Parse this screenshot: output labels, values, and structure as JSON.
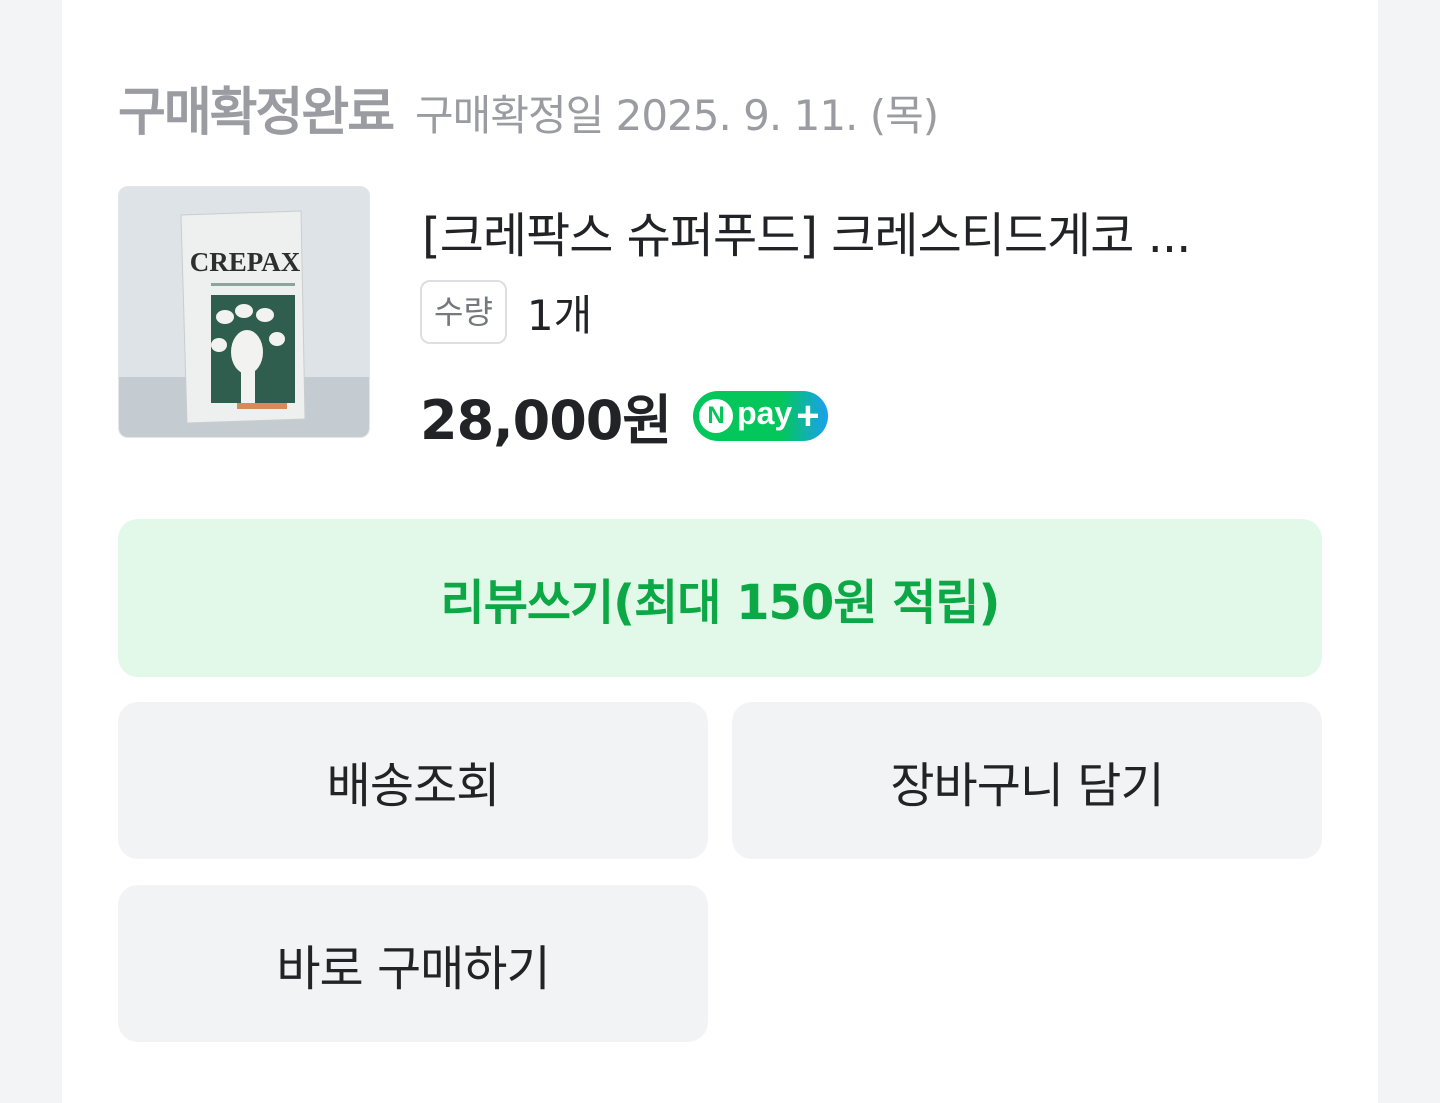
{
  "order": {
    "status_title": "구매확정완료",
    "status_date": "구매확정일 2025. 9. 11. (목)"
  },
  "product": {
    "title": "[크레팍스 슈퍼푸드] 크레스티드게코 ...",
    "image_brand_text": "CREPAX",
    "quantity_label": "수량",
    "quantity_value": "1개",
    "price": "28,000원",
    "npay_badge": {
      "n": "N",
      "text": "pay",
      "plus": "+"
    }
  },
  "buttons": {
    "review": "리뷰쓰기(최대 150원 적립)",
    "delivery": "배송조회",
    "cart": "장바구니 담기",
    "buy_now": "바로 구매하기"
  },
  "colors": {
    "review_bg": "#e2f8e8",
    "review_text": "#0ba845",
    "npay_green": "#03c75a",
    "npay_blue": "#1aa0f0",
    "status_gray": "#9a9ca1",
    "button_bg": "#f2f3f5"
  }
}
